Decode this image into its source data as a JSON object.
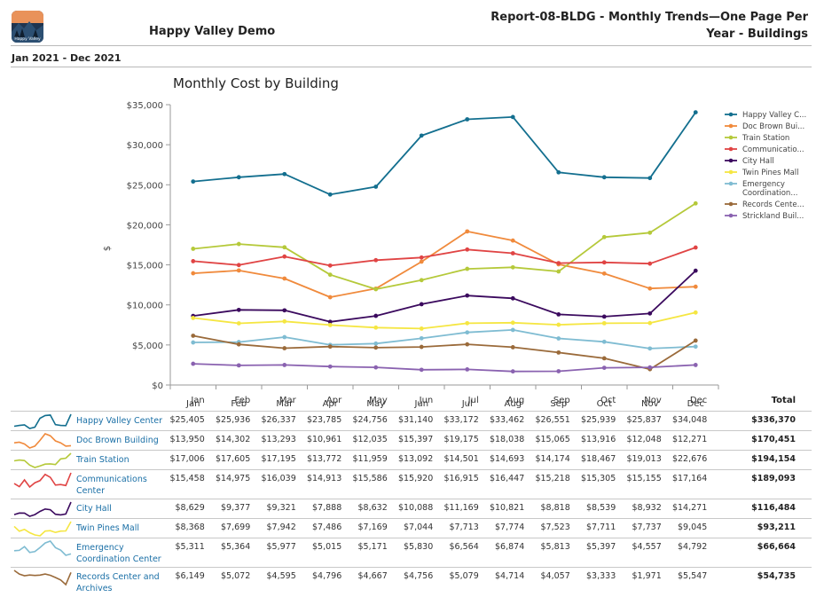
{
  "header": {
    "app_name": "Happy Valley Demo",
    "logo_text": "Happy Valley",
    "report_title": "Report-08-BLDG - Monthly Trends—One Page Per Year - Buildings",
    "date_range": "Jan 2021 - Dec 2021"
  },
  "table": {
    "total_label": "Total"
  },
  "chart_data": {
    "type": "line",
    "title": "Monthly Cost by Building",
    "xlabel": "",
    "ylabel": "$",
    "ylim": [
      0,
      35000
    ],
    "yticks": [
      "$0",
      "$5,000",
      "$10,000",
      "$15,000",
      "$20,000",
      "$25,000",
      "$30,000",
      "$35,000"
    ],
    "categories": [
      "Jan",
      "Feb",
      "Mar",
      "Apr",
      "May",
      "Jun",
      "Jul",
      "Aug",
      "Sep",
      "Oct",
      "Nov",
      "Dec"
    ],
    "legend_position": "right",
    "series": [
      {
        "name": "Happy Valley Center",
        "legend": "Happy Valley C...",
        "legend2": "",
        "color": "#136f8f",
        "values": [
          25405,
          25936,
          26337,
          23785,
          24756,
          31140,
          33172,
          33462,
          26551,
          25939,
          25837,
          34048
        ],
        "labels": [
          "$25,405",
          "$25,936",
          "$26,337",
          "$23,785",
          "$24,756",
          "$31,140",
          "$33,172",
          "$33,462",
          "$26,551",
          "$25,939",
          "$25,837",
          "$34,048"
        ],
        "total": "$336,370"
      },
      {
        "name": "Doc Brown Building",
        "legend": "Doc Brown Bui...",
        "legend2": "",
        "color": "#f08a3c",
        "values": [
          13950,
          14302,
          13293,
          10961,
          12035,
          15397,
          19175,
          18038,
          15065,
          13916,
          12048,
          12271
        ],
        "labels": [
          "$13,950",
          "$14,302",
          "$13,293",
          "$10,961",
          "$12,035",
          "$15,397",
          "$19,175",
          "$18,038",
          "$15,065",
          "$13,916",
          "$12,048",
          "$12,271"
        ],
        "total": "$170,451"
      },
      {
        "name": "Train Station",
        "legend": "Train Station",
        "legend2": "",
        "color": "#b5c93a",
        "values": [
          17006,
          17605,
          17195,
          13772,
          11959,
          13092,
          14501,
          14693,
          14174,
          18467,
          19013,
          22676
        ],
        "labels": [
          "$17,006",
          "$17,605",
          "$17,195",
          "$13,772",
          "$11,959",
          "$13,092",
          "$14,501",
          "$14,693",
          "$14,174",
          "$18,467",
          "$19,013",
          "$22,676"
        ],
        "total": "$194,154"
      },
      {
        "name": "Communications Center",
        "legend": "Communicatio...",
        "legend2": "",
        "color": "#e04444",
        "values": [
          15458,
          14975,
          16039,
          14913,
          15586,
          15920,
          16915,
          16447,
          15218,
          15305,
          15155,
          17164
        ],
        "labels": [
          "$15,458",
          "$14,975",
          "$16,039",
          "$14,913",
          "$15,586",
          "$15,920",
          "$16,915",
          "$16,447",
          "$15,218",
          "$15,305",
          "$15,155",
          "$17,164"
        ],
        "total": "$189,093"
      },
      {
        "name": "City Hall",
        "legend": "City Hall",
        "legend2": "",
        "color": "#3b0a5e",
        "values": [
          8629,
          9377,
          9321,
          7888,
          8632,
          10088,
          11169,
          10821,
          8818,
          8539,
          8932,
          14271
        ],
        "labels": [
          "$8,629",
          "$9,377",
          "$9,321",
          "$7,888",
          "$8,632",
          "$10,088",
          "$11,169",
          "$10,821",
          "$8,818",
          "$8,539",
          "$8,932",
          "$14,271"
        ],
        "total": "$116,484"
      },
      {
        "name": "Twin Pines Mall",
        "legend": "Twin Pines Mall",
        "legend2": "",
        "color": "#f5e642",
        "values": [
          8368,
          7699,
          7942,
          7486,
          7169,
          7044,
          7713,
          7774,
          7523,
          7711,
          7737,
          9045
        ],
        "labels": [
          "$8,368",
          "$7,699",
          "$7,942",
          "$7,486",
          "$7,169",
          "$7,044",
          "$7,713",
          "$7,774",
          "$7,523",
          "$7,711",
          "$7,737",
          "$9,045"
        ],
        "total": "$93,211"
      },
      {
        "name": "Emergency Coordination Center",
        "legend": "Emergency",
        "legend2": "Coordination...",
        "color": "#7fbcd2",
        "values": [
          5311,
          5364,
          5977,
          5015,
          5171,
          5830,
          6564,
          6874,
          5813,
          5397,
          4557,
          4792
        ],
        "labels": [
          "$5,311",
          "$5,364",
          "$5,977",
          "$5,015",
          "$5,171",
          "$5,830",
          "$6,564",
          "$6,874",
          "$5,813",
          "$5,397",
          "$4,557",
          "$4,792"
        ],
        "total": "$66,664"
      },
      {
        "name": "Records Center and Archives",
        "legend": "Records Cente...",
        "legend2": "",
        "color": "#9a6a3a",
        "values": [
          6149,
          5072,
          4595,
          4796,
          4667,
          4756,
          5079,
          4714,
          4057,
          3333,
          1971,
          5547
        ],
        "labels": [
          "$6,149",
          "$5,072",
          "$4,595",
          "$4,796",
          "$4,667",
          "$4,756",
          "$5,079",
          "$4,714",
          "$4,057",
          "$3,333",
          "$1,971",
          "$5,547"
        ],
        "total": "$54,735"
      },
      {
        "name": "Strickland Building",
        "legend": "Strickland Buil...",
        "legend2": "",
        "color": "#8a62b0",
        "values": [
          2650,
          2450,
          2500,
          2300,
          2200,
          1900,
          1950,
          1700,
          1720,
          2150,
          2200,
          2500
        ]
      }
    ]
  }
}
